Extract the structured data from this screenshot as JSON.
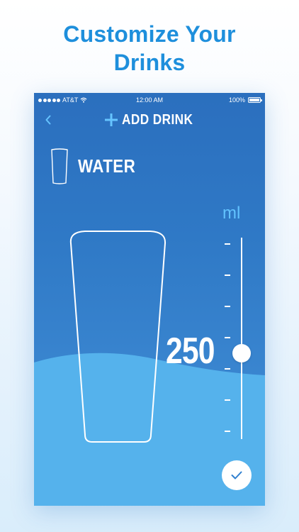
{
  "promo": {
    "title_line1": "Customize Your",
    "title_line2": "Drinks"
  },
  "status_bar": {
    "carrier": "AT&T",
    "time": "12:00 AM",
    "battery": "100%"
  },
  "nav": {
    "back_icon": "chevron-left-icon",
    "title": "ADD DRINK",
    "title_icon": "plus-icon"
  },
  "drink": {
    "name": "WATER",
    "icon": "glass-icon"
  },
  "amount": {
    "value": "250",
    "unit": "ml"
  },
  "confirm": {
    "icon": "checkmark-icon"
  },
  "colors": {
    "accent": "#1e8fdc",
    "screen_background": "#2f79c6",
    "light_blue": "#66c4ff",
    "water": "#55b2ec"
  }
}
